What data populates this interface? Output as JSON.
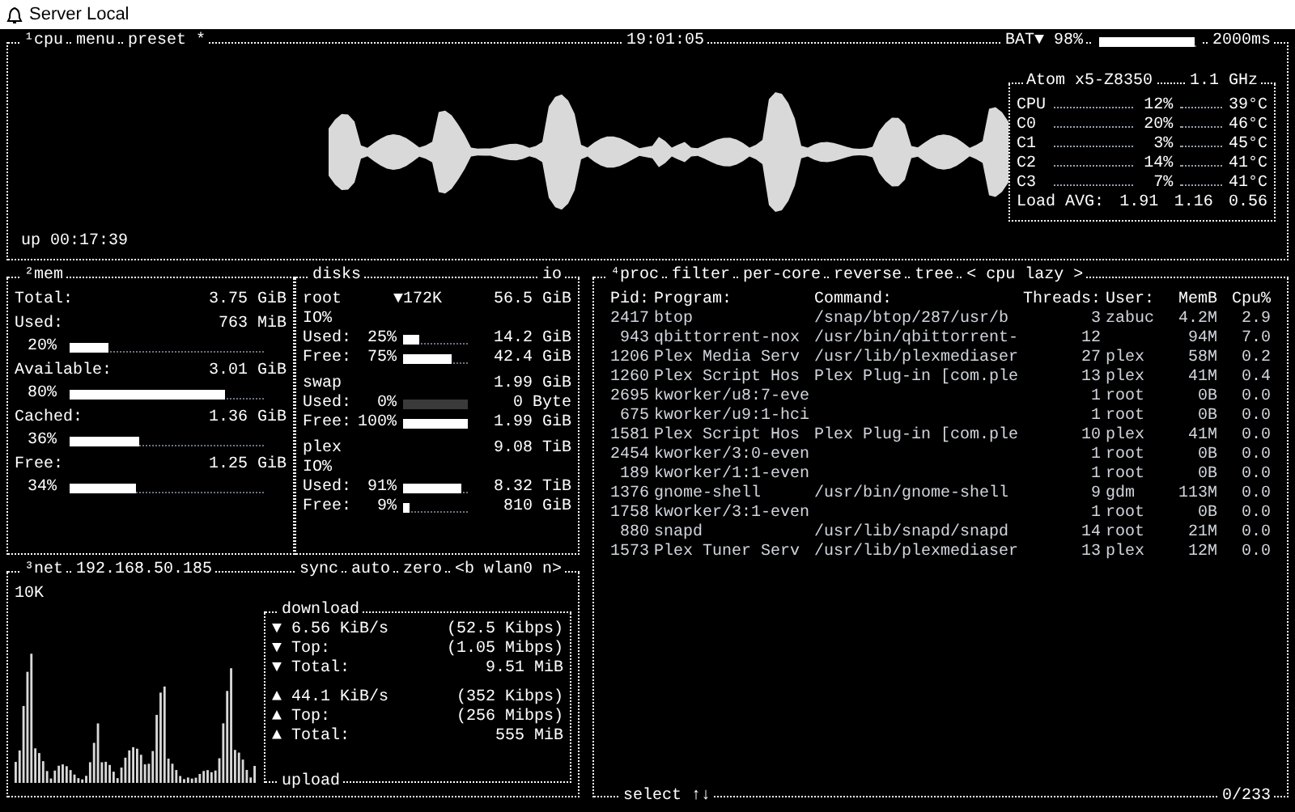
{
  "window": {
    "title": "Server Local"
  },
  "cpu": {
    "tabs": [
      "¹cpu",
      "menu",
      "preset *"
    ],
    "clock": "19:01:05",
    "battery": {
      "label": "BAT▼ 98%",
      "level": 0.98
    },
    "interval": "2000ms",
    "uptime": "up 00:17:39",
    "model": "Atom x5-Z8350",
    "freq": "1.1 GHz",
    "cores": [
      {
        "name": "CPU",
        "percent": "12%",
        "temp": "39°C"
      },
      {
        "name": "C0",
        "percent": "20%",
        "temp": "46°C"
      },
      {
        "name": "C1",
        "percent": "3%",
        "temp": "45°C"
      },
      {
        "name": "C2",
        "percent": "14%",
        "temp": "41°C"
      },
      {
        "name": "C3",
        "percent": "7%",
        "temp": "41°C"
      }
    ],
    "load": {
      "label": "Load AVG:",
      "values": [
        "1.91",
        "1.16",
        "0.56"
      ]
    }
  },
  "mem": {
    "title": "²mem",
    "rows": [
      {
        "label": "Total:",
        "value": "3.75 GiB"
      },
      {
        "label": "Used:",
        "value": "763 MiB",
        "percent": "20%",
        "level": 0.2
      },
      {
        "label": "Available:",
        "value": "3.01 GiB",
        "percent": "80%",
        "level": 0.8
      },
      {
        "label": "Cached:",
        "value": "1.36 GiB",
        "percent": "36%",
        "level": 0.36
      },
      {
        "label": "Free:",
        "value": "1.25 GiB",
        "percent": "34%",
        "level": 0.34
      }
    ]
  },
  "disks": {
    "title": "disks",
    "io": "io",
    "items": [
      {
        "name": "root",
        "io": "▼172K",
        "size": "56.5 GiB",
        "io_label": "IO%",
        "used": {
          "label": "Used:",
          "percent": "25%",
          "level": 0.25,
          "value": "14.2 GiB"
        },
        "free": {
          "label": "Free:",
          "percent": "75%",
          "level": 0.75,
          "value": "42.4 GiB"
        }
      },
      {
        "name": "swap",
        "size": "1.99 GiB",
        "used": {
          "label": "Used:",
          "percent": "0%",
          "level": 0,
          "value": "0 Byte"
        },
        "free": {
          "label": "Free:",
          "percent": "100%",
          "level": 1,
          "value": "1.99 GiB"
        }
      },
      {
        "name": "plex",
        "size": "9.08 TiB",
        "io_label": "IO%",
        "used": {
          "label": "Used:",
          "percent": "91%",
          "level": 0.91,
          "value": "8.32 TiB"
        },
        "free": {
          "label": "Free:",
          "percent": "9%",
          "level": 0.09,
          "value": "810 GiB"
        }
      }
    ]
  },
  "net": {
    "title": "³net",
    "ip": "192.168.50.185",
    "tabs": [
      "sync",
      "auto",
      "zero"
    ],
    "iface": "<b wlan0 n>",
    "scale": "10K",
    "download_label": "download",
    "upload_label": "upload",
    "download": [
      {
        "arrow": "▼",
        "label": "6.56 KiB/s",
        "value": "(52.5 Kibps)"
      },
      {
        "arrow": "▼",
        "label": "Top:",
        "value": "(1.05 Mibps)"
      },
      {
        "arrow": "▼",
        "label": "Total:",
        "value": "9.51 MiB"
      }
    ],
    "upload": [
      {
        "arrow": "▲",
        "label": "44.1 KiB/s",
        "value": "(352 Kibps)"
      },
      {
        "arrow": "▲",
        "label": "Top:",
        "value": "(256 Mibps)"
      },
      {
        "arrow": "▲",
        "label": "Total:",
        "value": "555 MiB"
      }
    ]
  },
  "proc": {
    "title": "⁴proc",
    "tabs": [
      "filter",
      "per-core",
      "reverse",
      "tree",
      "< cpu lazy >"
    ],
    "columns": [
      "Pid:",
      "Program:",
      "Command:",
      "Threads:",
      "User:",
      "MemB",
      "Cpu%"
    ],
    "rows": [
      [
        "2417",
        "btop",
        "/snap/btop/287/usr/b",
        "3",
        "zabuc",
        "4.2M",
        "2.9"
      ],
      [
        "943",
        "qbittorrent-nox",
        "/usr/bin/qbittorrent-",
        "12",
        "",
        "94M",
        "7.0"
      ],
      [
        "1206",
        "Plex Media Serv",
        "/usr/lib/plexmediaser",
        "27",
        "plex",
        "58M",
        "0.2"
      ],
      [
        "1260",
        "Plex Script Hos",
        "Plex Plug-in [com.ple",
        "13",
        "plex",
        "41M",
        "0.4"
      ],
      [
        "2695",
        "kworker/u8:7-eve",
        "",
        "1",
        "root",
        "0B",
        "0.0"
      ],
      [
        "675",
        "kworker/u9:1-hci",
        "",
        "1",
        "root",
        "0B",
        "0.0"
      ],
      [
        "1581",
        "Plex Script Hos",
        "Plex Plug-in [com.ple",
        "10",
        "plex",
        "41M",
        "0.0"
      ],
      [
        "2454",
        "kworker/3:0-even",
        "",
        "1",
        "root",
        "0B",
        "0.0"
      ],
      [
        "189",
        "kworker/1:1-even",
        "",
        "1",
        "root",
        "0B",
        "0.0"
      ],
      [
        "1376",
        "gnome-shell",
        "/usr/bin/gnome-shell",
        "9",
        "gdm",
        "113M",
        "0.0"
      ],
      [
        "1758",
        "kworker/3:1-even",
        "",
        "1",
        "root",
        "0B",
        "0.0"
      ],
      [
        "880",
        "snapd",
        "/usr/lib/snapd/snapd",
        "14",
        "root",
        "21M",
        "0.0"
      ],
      [
        "1573",
        "Plex Tuner Serv",
        "/usr/lib/plexmediaser",
        "13",
        "plex",
        "12M",
        "0.0"
      ]
    ],
    "footer": "select ↑↓",
    "count": "0/233"
  }
}
